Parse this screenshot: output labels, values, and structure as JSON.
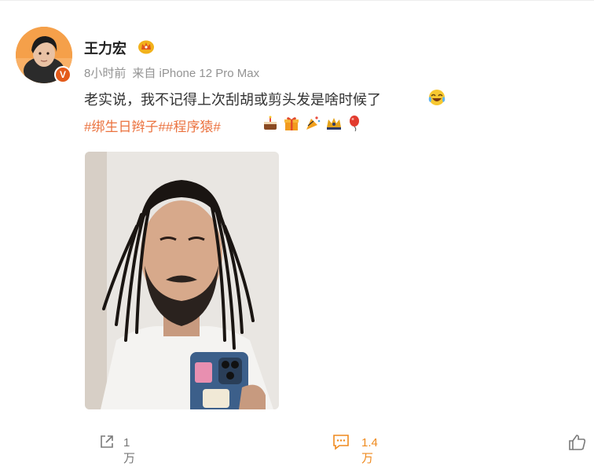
{
  "post": {
    "author": "王力宏",
    "time": "8小时前",
    "source": "来自 iPhone 12 Pro Max",
    "text": "老实说，我不记得上次刮胡或剪头发是啥时候了",
    "hashtags": [
      "#绑生日辫子#",
      "#程序猿#"
    ],
    "verified_badge": "V"
  },
  "icons": {
    "crown": "crown-badge-icon",
    "laugh": "laughing-tears-icon",
    "emojis": [
      "cake-icon",
      "gift-icon",
      "party-horn-icon",
      "crown-icon",
      "balloon-icon"
    ]
  },
  "footer": {
    "share_count": "1万",
    "comment_count": "1.4万"
  },
  "colors": {
    "hashtag": "#eb7340",
    "meta": "#939393",
    "comment_accent": "#ef8a1e",
    "badge": "#e35b1b"
  }
}
